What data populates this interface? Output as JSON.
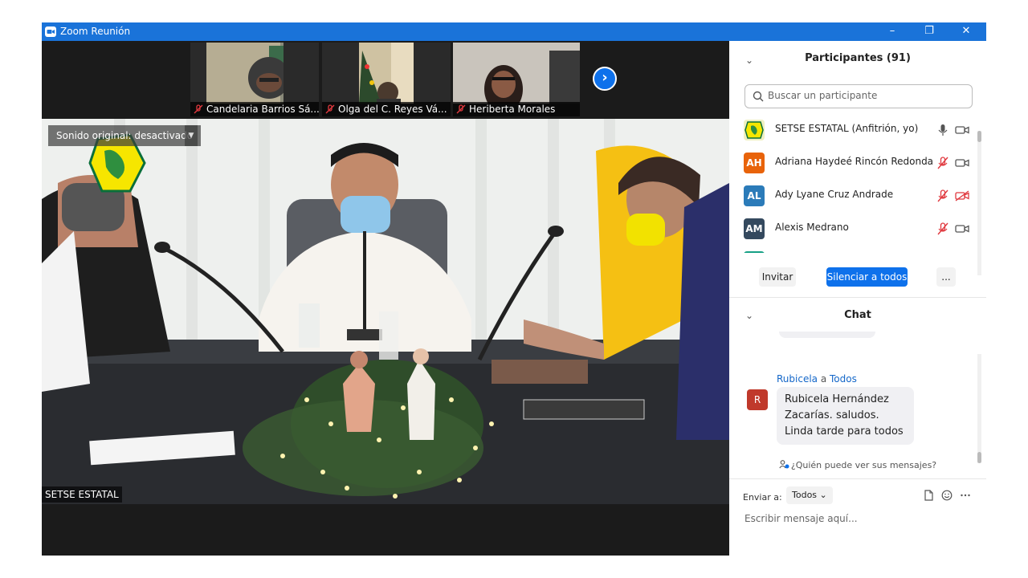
{
  "window": {
    "title": "Zoom Reunión",
    "controls": {
      "minimize": "–",
      "restore": "❐",
      "close": "✕"
    }
  },
  "thumbnails": [
    {
      "name": "Candelaria Barrios Sá..."
    },
    {
      "name": "Olga del C. Reyes Vá..."
    },
    {
      "name": "Heriberta Morales"
    }
  ],
  "strip": {
    "next_label": "›"
  },
  "main_video": {
    "original_sound": "Sonido original: desactivado",
    "speaker_label": "SETSE ESTATAL"
  },
  "participants": {
    "title": "Participantes (91)",
    "search_placeholder": "Buscar un participante",
    "items": [
      {
        "name": "SETSE ESTATAL (Anfitrión, yo)",
        "initials": "",
        "color": "#f0f0c0",
        "muted": false,
        "video_off": false
      },
      {
        "name": "Adriana Haydeé Rincón Redonda",
        "initials": "AH",
        "color": "#e8630a",
        "muted": true,
        "video_off": false
      },
      {
        "name": "Ady Lyane Cruz Andrade",
        "initials": "AL",
        "color": "#2b7bb9",
        "muted": true,
        "video_off": true
      },
      {
        "name": "Alexis Medrano",
        "initials": "AM",
        "color": "#34495e",
        "muted": true,
        "video_off": false
      },
      {
        "name": "",
        "initials": "",
        "color": "#16a085",
        "muted": true,
        "video_off": false
      }
    ],
    "invite_label": "Invitar",
    "mute_all_label": "Silenciar a todos",
    "more_label": "..."
  },
  "chat": {
    "title": "Chat",
    "message": {
      "sender": "Rubicela",
      "connector": " a ",
      "recipient": "Todos",
      "avatar_initial": "R",
      "lines": [
        "Rubicela Hernández",
        "Zacarías.  saludos.",
        "Linda tarde para todos"
      ]
    },
    "who_can_see": "¿Quién puede ver sus mensajes?",
    "send_to_label": "Enviar a:",
    "send_to_value": "Todos",
    "input_placeholder": "Escribir mensaje aquí..."
  }
}
